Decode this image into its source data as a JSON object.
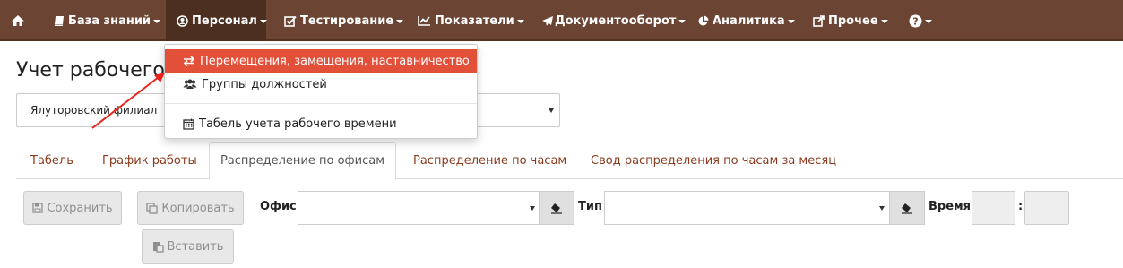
{
  "navbar": {
    "items": [
      {
        "label": "",
        "icon": "home-icon"
      },
      {
        "label": "База знаний",
        "icon": "book-icon"
      },
      {
        "label": "Персонал",
        "icon": "user-circle-icon"
      },
      {
        "label": "Тестирование",
        "icon": "checkbox-icon"
      },
      {
        "label": "Показатели",
        "icon": "line-chart-icon"
      },
      {
        "label": "Документооборот",
        "icon": "paper-plane-icon"
      },
      {
        "label": "Аналитика",
        "icon": "pie-chart-icon"
      },
      {
        "label": "Прочее",
        "icon": "external-link-icon"
      },
      {
        "label": "",
        "icon": "question-circle-icon"
      }
    ],
    "colors": {
      "background": "#6b4433",
      "active": "#4d2f20"
    }
  },
  "dropdown": {
    "items": [
      {
        "label": "Перемещения, замещения, наставничество",
        "icon": "exchange-icon"
      },
      {
        "label": "Группы должностей",
        "icon": "users-icon"
      },
      {
        "label": "Табель учета рабочего времени",
        "icon": "calendar-icon"
      }
    ],
    "highlight_color": "#e2503a"
  },
  "page": {
    "title": "Учет рабочего"
  },
  "filial": {
    "value": "Ялуторовский филиал"
  },
  "tabs": [
    {
      "label": "Табель"
    },
    {
      "label": "График работы"
    },
    {
      "label": "Распределение по офисам"
    },
    {
      "label": "Распределение по часам"
    },
    {
      "label": "Свод распределения по часам за месяц"
    }
  ],
  "toolbar": {
    "save_label": "Сохранить",
    "copy_label": "Копировать",
    "paste_label": "Вставить",
    "office_label": "Офис",
    "office_value": "",
    "type_label": "Тип",
    "type_value": "",
    "time_label": "Время",
    "time_separator": ":"
  },
  "annotation_color": "#e8231c"
}
